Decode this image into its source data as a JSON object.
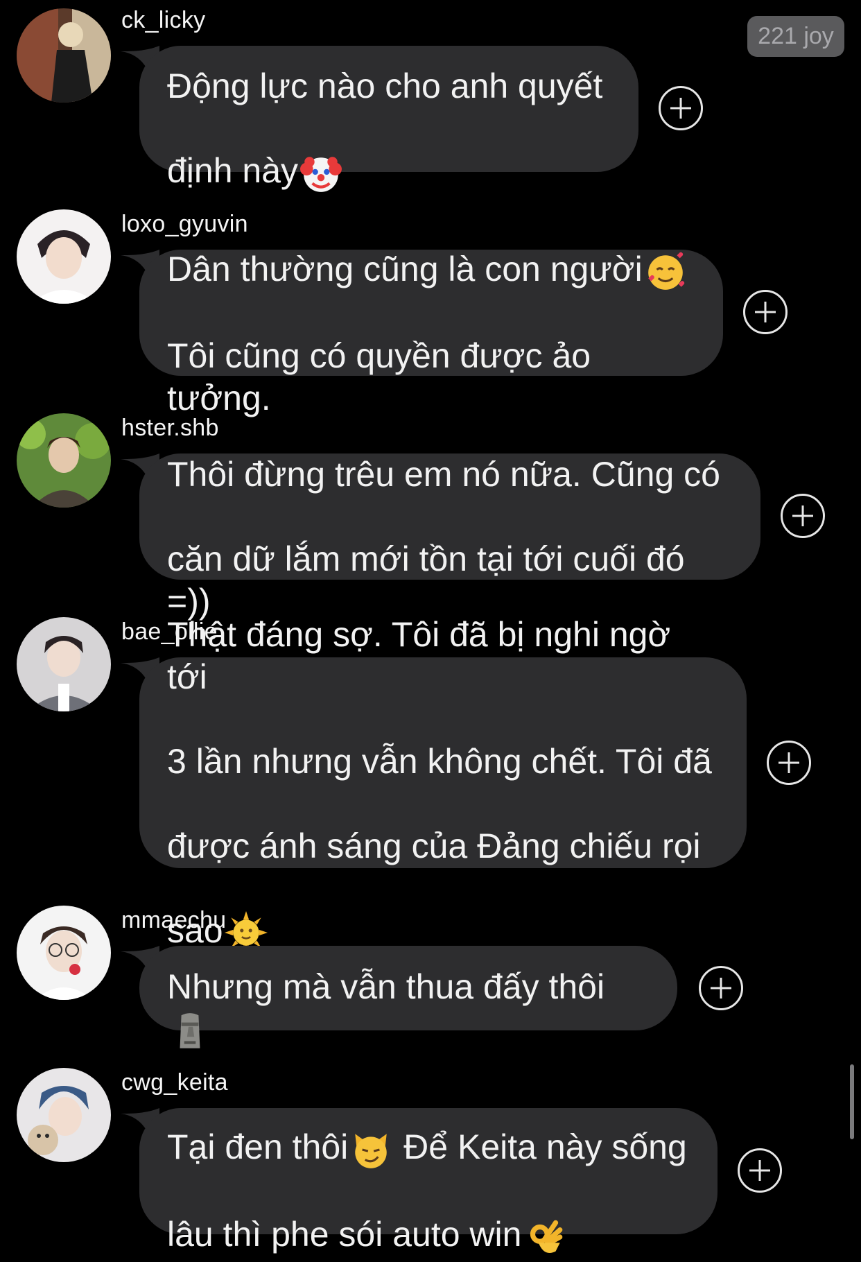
{
  "badge": {
    "label": "221 joy"
  },
  "comments": [
    {
      "username": "ck_licky",
      "lines": [
        "Động lực nào cho anh quyết",
        "định này"
      ],
      "emoji": [
        "clown-emoji"
      ]
    },
    {
      "username": "loxo_gyuvin",
      "lines": [
        "Dân thường cũng là con người",
        "Tôi cũng có quyền được ảo tưởng."
      ],
      "emoji": [
        "smiling-face-with-hearts-emoji"
      ]
    },
    {
      "username": "hster.shb",
      "lines": [
        "Thôi đừng trêu em nó nữa. Cũng có",
        "căn dữ lắm mới tồn tại tới cuối đó =))"
      ]
    },
    {
      "username": "bae_ollie",
      "lines": [
        "Thật đáng sợ. Tôi đã bị nghi ngờ tới",
        "3 lần nhưng vẫn không chết. Tôi đã",
        "được ánh sáng của Đảng chiếu rọi",
        "sao"
      ],
      "emoji": [
        "sun-with-face-emoji"
      ]
    },
    {
      "username": "mmaechu",
      "lines": [
        "Nhưng mà vẫn thua đấy thôi"
      ],
      "emoji": [
        "moai-emoji"
      ]
    },
    {
      "username": "cwg_keita",
      "lines": [
        "Tại đen thôi",
        " Để Keita này sống",
        "lâu thì phe sói auto win"
      ],
      "emoji": [
        "smirking-cat-emoji",
        "ok-hand-emoji"
      ]
    }
  ],
  "colors": {
    "background": "#000000",
    "bubble": "#2d2d2f",
    "badge": "#5a5a5c",
    "text": "#f2f2f2"
  }
}
